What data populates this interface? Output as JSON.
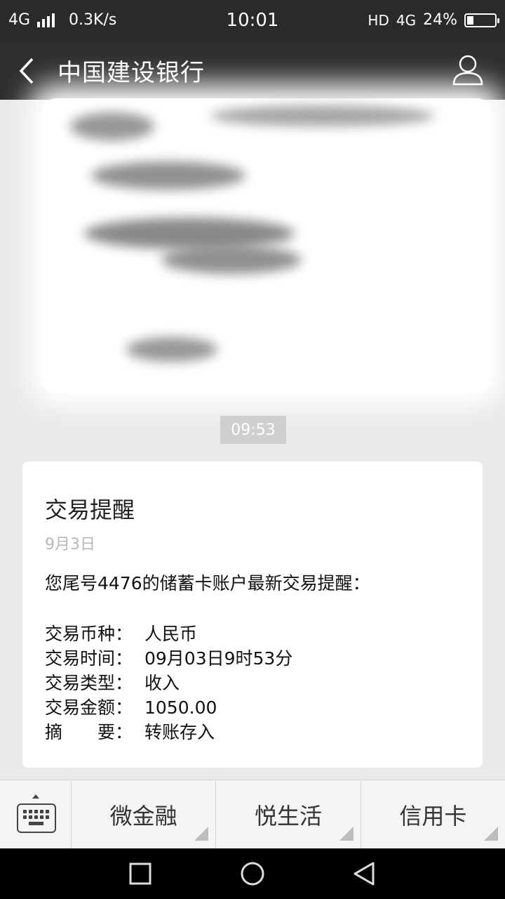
{
  "status_bar": {
    "network_left": "4G",
    "speed": "0.3K/s",
    "time": "10:01",
    "hd": "HD",
    "network_right": "4G",
    "battery_text": "24%",
    "battery_level": 0.24
  },
  "header": {
    "title": "中国建设银行",
    "back_icon": "chevron-left-icon",
    "profile_icon": "person-icon"
  },
  "chat": {
    "timestamp": "09:53",
    "message": {
      "title": "交易提醒",
      "date": "9月3日",
      "intro": "您尾号4476的储蓄卡账户最新交易提醒：",
      "details": [
        {
          "label": "交易币种：",
          "value": "人民币"
        },
        {
          "label": "交易时间：",
          "value": "09月03日9时53分"
        },
        {
          "label": "交易类型：",
          "value": "收入"
        },
        {
          "label": "交易金额：",
          "value": "1050.00"
        },
        {
          "label": "摘　　要：",
          "value": "转账存入"
        }
      ]
    }
  },
  "bottom_menu": {
    "keyboard_icon": "keyboard-icon",
    "items": [
      {
        "label": "微金融"
      },
      {
        "label": "悦生活"
      },
      {
        "label": "信用卡"
      }
    ]
  },
  "nav_bar": {
    "recent_icon": "square-icon",
    "home_icon": "circle-icon",
    "back_icon": "triangle-back-icon"
  }
}
